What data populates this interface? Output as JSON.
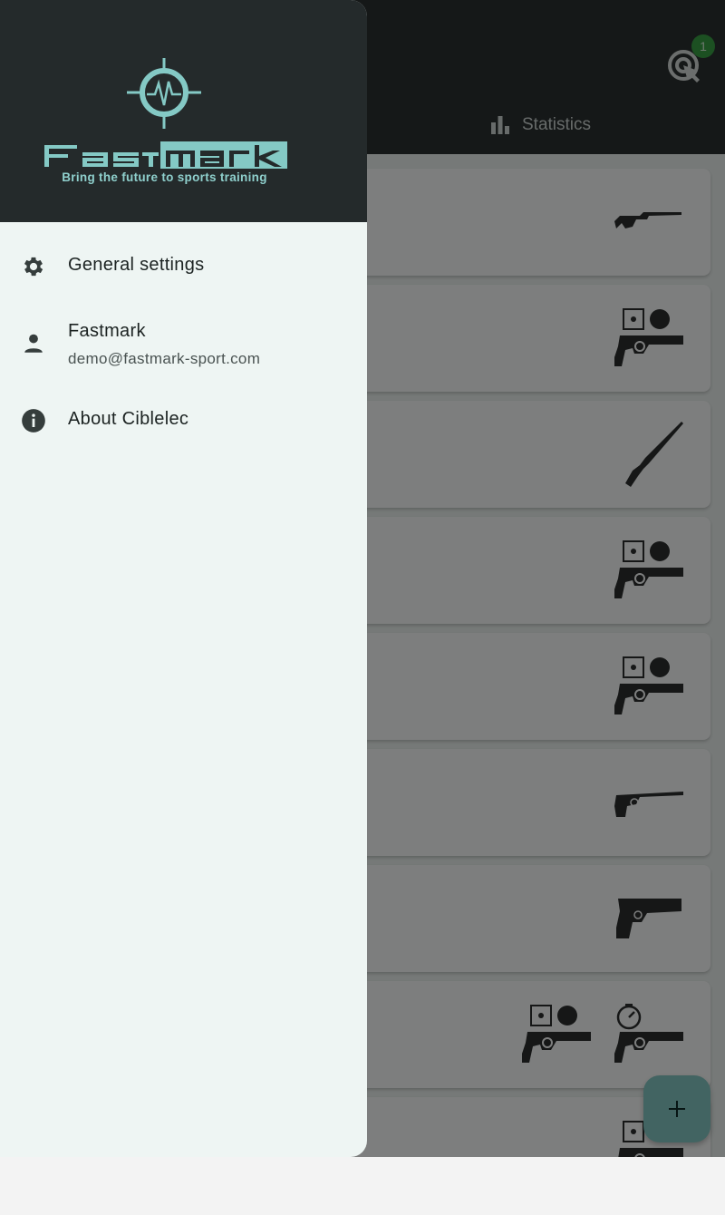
{
  "app": {
    "tabs": {
      "statistics_label": "Statistics"
    },
    "notification_count": "1",
    "cards": [
      {
        "icons": [
          "rifle-air-icon"
        ]
      },
      {
        "icons": [
          "pistol-target-icon"
        ]
      },
      {
        "icons": [
          "rifle-long-icon"
        ]
      },
      {
        "icons": [
          "pistol-target-icon"
        ]
      },
      {
        "icons": [
          "pistol-target-icon"
        ]
      },
      {
        "icons": [
          "pistol-free-icon"
        ]
      },
      {
        "icons": [
          "pistol-semi-icon"
        ]
      },
      {
        "icons": [
          "pistol-target-icon",
          "pistol-timer-icon"
        ]
      },
      {
        "icons": [
          "pistol-target-icon"
        ]
      }
    ],
    "fab_icon": "add-icon"
  },
  "drawer": {
    "brand": {
      "name": "FastMark",
      "tagline": "Bring the future to sports training"
    },
    "items": [
      {
        "icon": "gear-icon",
        "label": "General settings"
      },
      {
        "icon": "person-icon",
        "label": "Fastmark",
        "sublabel": "demo@fastmark-sport.com"
      },
      {
        "icon": "info-icon",
        "label": "About Ciblelec"
      }
    ]
  },
  "colors": {
    "accent": "#84c9c5",
    "header_dark": "#242a2b",
    "drawer_bg": "#eef5f3",
    "badge_green": "#38a045"
  }
}
